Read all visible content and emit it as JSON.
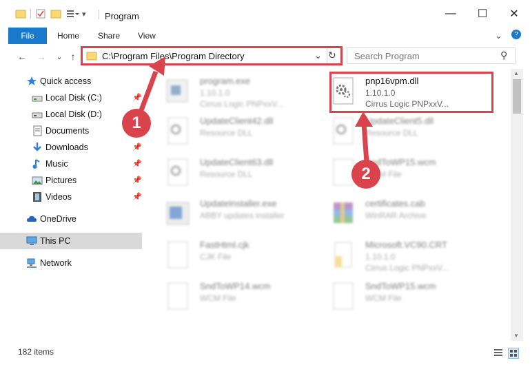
{
  "window": {
    "title": "Program",
    "minimize_glyph": "—",
    "maximize_glyph": "☐",
    "close_glyph": "✕"
  },
  "ribbon": {
    "tabs": [
      "File",
      "Home",
      "Share",
      "View"
    ],
    "expand_glyph": "⌄",
    "help_glyph": "?"
  },
  "nav": {
    "back_glyph": "←",
    "forward_glyph": "→",
    "recent_glyph": "⌄",
    "up_glyph": "↑",
    "address": "C:\\Program Files\\Program Directory",
    "address_dropdown_glyph": "⌄",
    "refresh_glyph": "↻",
    "search_placeholder": "Search Program",
    "search_glyph": "⚲"
  },
  "sidebar": {
    "items": [
      {
        "label": "Quick access",
        "icon": "star-icon",
        "pinned": false
      },
      {
        "label": "Local Disk (C:)",
        "icon": "drive-icon",
        "pinned": true
      },
      {
        "label": "Local Disk (D:)",
        "icon": "drive-icon",
        "pinned": false
      },
      {
        "label": "Documents",
        "icon": "documents-icon",
        "pinned": false
      },
      {
        "label": "Downloads",
        "icon": "download-icon",
        "pinned": true
      },
      {
        "label": "Music",
        "icon": "music-icon",
        "pinned": true
      },
      {
        "label": "Pictures",
        "icon": "pictures-icon",
        "pinned": true
      },
      {
        "label": "Videos",
        "icon": "videos-icon",
        "pinned": true
      },
      {
        "label": "OneDrive",
        "icon": "cloud-icon",
        "pinned": false
      },
      {
        "label": "This PC",
        "icon": "computer-icon",
        "pinned": false,
        "selected": true
      },
      {
        "label": "Network",
        "icon": "network-icon",
        "pinned": false
      }
    ],
    "pin_glyph": "📌"
  },
  "files": [
    {
      "name": "program.exe",
      "line2": "1.10.1.0",
      "line3": "Cirrus Logic PNPxxV...",
      "icon": "exe-icon",
      "faded": true
    },
    {
      "name": "pnp16vpm.dll",
      "line2": "1.10.1.0",
      "line3": "Cirrus Logic PNPxxV...",
      "icon": "dll-gear-icon",
      "faded": false,
      "highlighted": true
    },
    {
      "name": "UpdateClient42.dll",
      "line2": "Resource DLL",
      "line3": "",
      "icon": "dll-gear-icon",
      "faded": true
    },
    {
      "name": "UpdateClient5.dll",
      "line2": "Resource DLL",
      "line3": "",
      "icon": "dll-gear-icon",
      "faded": true
    },
    {
      "name": "UpdateClient63.dll",
      "line2": "Resource DLL",
      "line3": "",
      "icon": "dll-gear-icon",
      "faded": true
    },
    {
      "name": "SndToWP15.wcm",
      "line2": "WCM File",
      "line3": "",
      "icon": "file-icon",
      "faded": true
    },
    {
      "name": "UpdateInstaller.exe",
      "line2": "ABBY updates installer",
      "line3": "",
      "icon": "installer-icon",
      "faded": true
    },
    {
      "name": "certificates.cab",
      "line2": "WinRAR Archive",
      "line3": "",
      "icon": "archive-icon",
      "faded": true
    },
    {
      "name": "FastHtml.cjk",
      "line2": "CJK File",
      "line3": "",
      "icon": "file-icon",
      "faded": true
    },
    {
      "name": "Microsoft.VC90.CRT",
      "line2": "1.10.1.0",
      "line3": "Cirrus Logic PNPxxV...",
      "icon": "folder-icon",
      "faded": true
    },
    {
      "name": "SndToWP14.wcm",
      "line2": "WCM File",
      "line3": "",
      "icon": "file-icon",
      "faded": true
    },
    {
      "name": "SndToWP15.wcm",
      "line2": "WCM File",
      "line3": "",
      "icon": "file-icon",
      "faded": true
    }
  ],
  "status": {
    "item_count": "182 items"
  },
  "annotations": {
    "marker_1": "1",
    "marker_2": "2"
  },
  "colors": {
    "accent": "#1979ca",
    "highlight": "#d9434b"
  }
}
